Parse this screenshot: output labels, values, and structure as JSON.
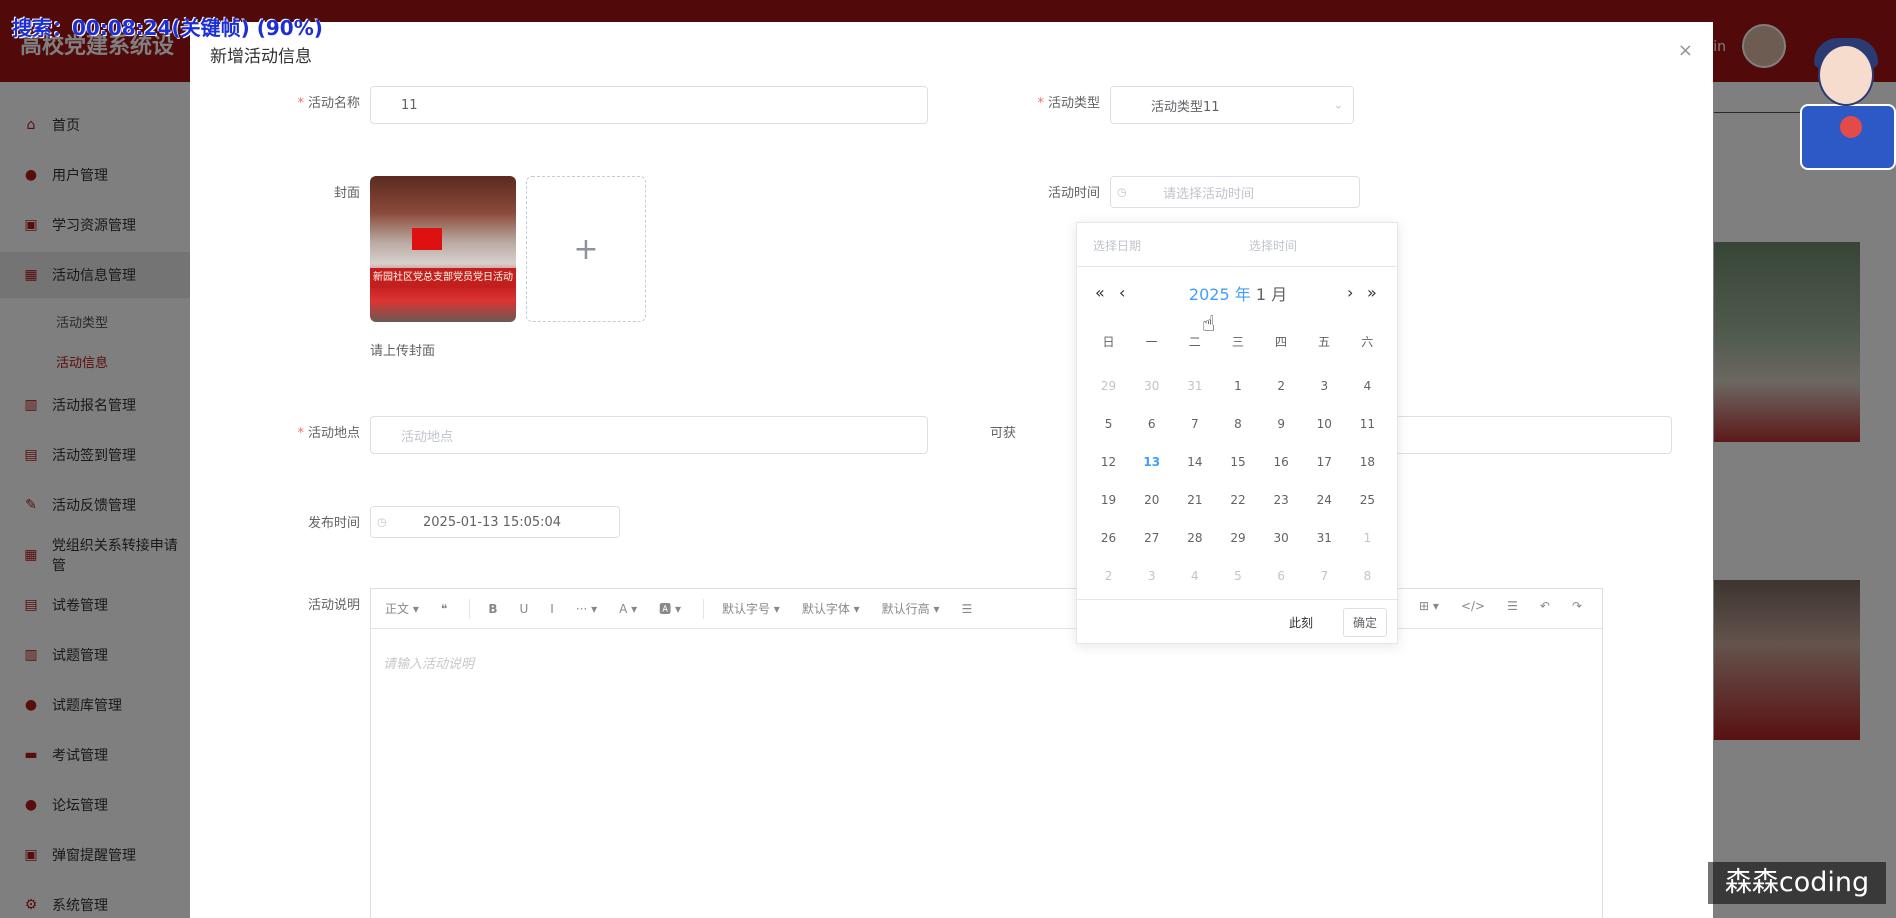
{
  "osd": {
    "text": "搜索：00:08:24(关键帧) (90%)"
  },
  "app": {
    "brand": "高校党建系统设",
    "welcome": "欢迎 admin",
    "sidebar": {
      "items": [
        {
          "label": "首页",
          "icon": "home-icon"
        },
        {
          "label": "用户管理",
          "icon": "user-icon"
        },
        {
          "label": "学习资源管理",
          "icon": "car-icon"
        },
        {
          "label": "活动信息管理",
          "icon": "grid-icon"
        },
        {
          "label": "活动报名管理",
          "icon": "books-icon"
        },
        {
          "label": "活动签到管理",
          "icon": "gift-icon"
        },
        {
          "label": "活动反馈管理",
          "icon": "edit-icon"
        },
        {
          "label": "党组织关系转接申请管",
          "icon": "table-icon"
        },
        {
          "label": "试卷管理",
          "icon": "document-icon"
        },
        {
          "label": "试题管理",
          "icon": "list-icon"
        },
        {
          "label": "试题库管理",
          "icon": "disc-icon"
        },
        {
          "label": "考试管理",
          "icon": "menu-icon"
        },
        {
          "label": "论坛管理",
          "icon": "chat-icon"
        },
        {
          "label": "弹窗提醒管理",
          "icon": "window-icon"
        },
        {
          "label": "系统管理",
          "icon": "settings-icon"
        }
      ],
      "sub_items": [
        "活动类型",
        "活动信息"
      ]
    }
  },
  "dialog": {
    "title": "新增活动信息",
    "close": "×",
    "name": {
      "label": "活动名称",
      "value": "11"
    },
    "type": {
      "label": "活动类型",
      "value": "活动类型11"
    },
    "cover": {
      "label": "封面",
      "banner": "新园社区党总支部党员党日活动",
      "hint": "请上传封面",
      "plus": "+"
    },
    "time": {
      "label": "活动时间",
      "placeholder": "请选择活动时间"
    },
    "location": {
      "label": "活动地点",
      "placeholder": "活动地点"
    },
    "points": {
      "label": "可获"
    },
    "publish": {
      "label": "发布时间",
      "value": "2025-01-13 15:05:04"
    },
    "desc": {
      "label": "活动说明",
      "placeholder": "请输入活动说明",
      "toolbar": [
        "正文 ▾",
        "❝",
        "B",
        "U",
        "I",
        "··· ▾",
        "A ▾",
        "🅰 ▾",
        "默认字号 ▾",
        "默认字体 ▾",
        "默认行高 ▾",
        "☰"
      ],
      "toolbar_right": [
        "⊞ ▾",
        "</>",
        "☰",
        "↶",
        "↷"
      ]
    }
  },
  "picker": {
    "date_field": "选择日期",
    "time_field": "选择时间",
    "year": "2025 年",
    "month": "1 月",
    "nav_prev_year": "«",
    "nav_prev_month": "‹",
    "nav_next_month": "›",
    "nav_next_year": "»",
    "weekdays": [
      "日",
      "一",
      "二",
      "三",
      "四",
      "五",
      "六"
    ],
    "days": [
      [
        "29",
        "muted"
      ],
      [
        "30",
        "muted"
      ],
      [
        "31",
        "muted"
      ],
      [
        "1",
        ""
      ],
      [
        "2",
        ""
      ],
      [
        "3",
        ""
      ],
      [
        "4",
        ""
      ],
      [
        "5",
        ""
      ],
      [
        "6",
        ""
      ],
      [
        "7",
        ""
      ],
      [
        "8",
        ""
      ],
      [
        "9",
        ""
      ],
      [
        "10",
        ""
      ],
      [
        "11",
        ""
      ],
      [
        "12",
        ""
      ],
      [
        "13",
        "today"
      ],
      [
        "14",
        ""
      ],
      [
        "15",
        ""
      ],
      [
        "16",
        ""
      ],
      [
        "17",
        ""
      ],
      [
        "18",
        ""
      ],
      [
        "19",
        ""
      ],
      [
        "20",
        ""
      ],
      [
        "21",
        ""
      ],
      [
        "22",
        ""
      ],
      [
        "23",
        ""
      ],
      [
        "24",
        ""
      ],
      [
        "25",
        ""
      ],
      [
        "26",
        ""
      ],
      [
        "27",
        ""
      ],
      [
        "28",
        ""
      ],
      [
        "29",
        ""
      ],
      [
        "30",
        ""
      ],
      [
        "31",
        ""
      ],
      [
        "1",
        "muted"
      ],
      [
        "2",
        "muted"
      ],
      [
        "3",
        "muted"
      ],
      [
        "4",
        "muted"
      ],
      [
        "5",
        "muted"
      ],
      [
        "6",
        "muted"
      ],
      [
        "7",
        "muted"
      ],
      [
        "8",
        "muted"
      ]
    ],
    "now": "此刻",
    "ok": "确定"
  },
  "watermark": "森森coding",
  "colors": {
    "brand_red": "#a31212",
    "accent_blue": "#409eff",
    "required": "#f56c6c"
  }
}
